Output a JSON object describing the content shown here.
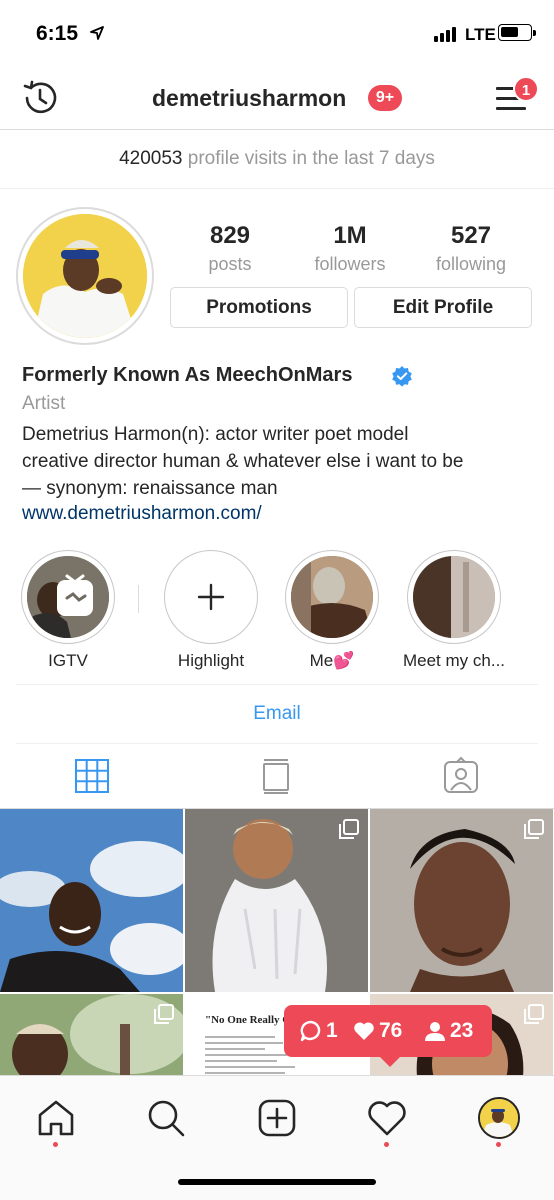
{
  "status_bar": {
    "time": "6:15",
    "network": "LTE"
  },
  "header": {
    "username": "demetriusharmon",
    "notifications_badge": "9+",
    "menu_badge": "1"
  },
  "visits": {
    "count": "420053",
    "text": "profile visits in the last 7 days"
  },
  "stats": [
    {
      "value": "829",
      "label": "posts"
    },
    {
      "value": "1M",
      "label": "followers"
    },
    {
      "value": "527",
      "label": "following"
    }
  ],
  "buttons": {
    "promotions": "Promotions",
    "edit_profile": "Edit Profile"
  },
  "profile": {
    "full_name": "Formerly Known As MeechOnMars",
    "category": "Artist",
    "bio_lines": [
      "Demetrius Harmon(n): actor writer poet model",
      "creative director human & whatever else i want to be",
      "— synonym: renaissance man"
    ],
    "website": "www.demetriusharmon.com/"
  },
  "highlights": [
    {
      "label": "IGTV"
    },
    {
      "label": "Highlight"
    },
    {
      "label": "Me💕"
    },
    {
      "label": "Meet my ch..."
    }
  ],
  "contact": {
    "email_label": "Email"
  },
  "grid_text": {
    "note_title": "\"No One Really Care"
  },
  "activity": {
    "comments": "1",
    "likes": "76",
    "followers": "23"
  },
  "colors": {
    "accent_red": "#ed4956",
    "link_blue": "#3897f0",
    "website_blue": "#003569",
    "verified_blue": "#3897f0"
  }
}
